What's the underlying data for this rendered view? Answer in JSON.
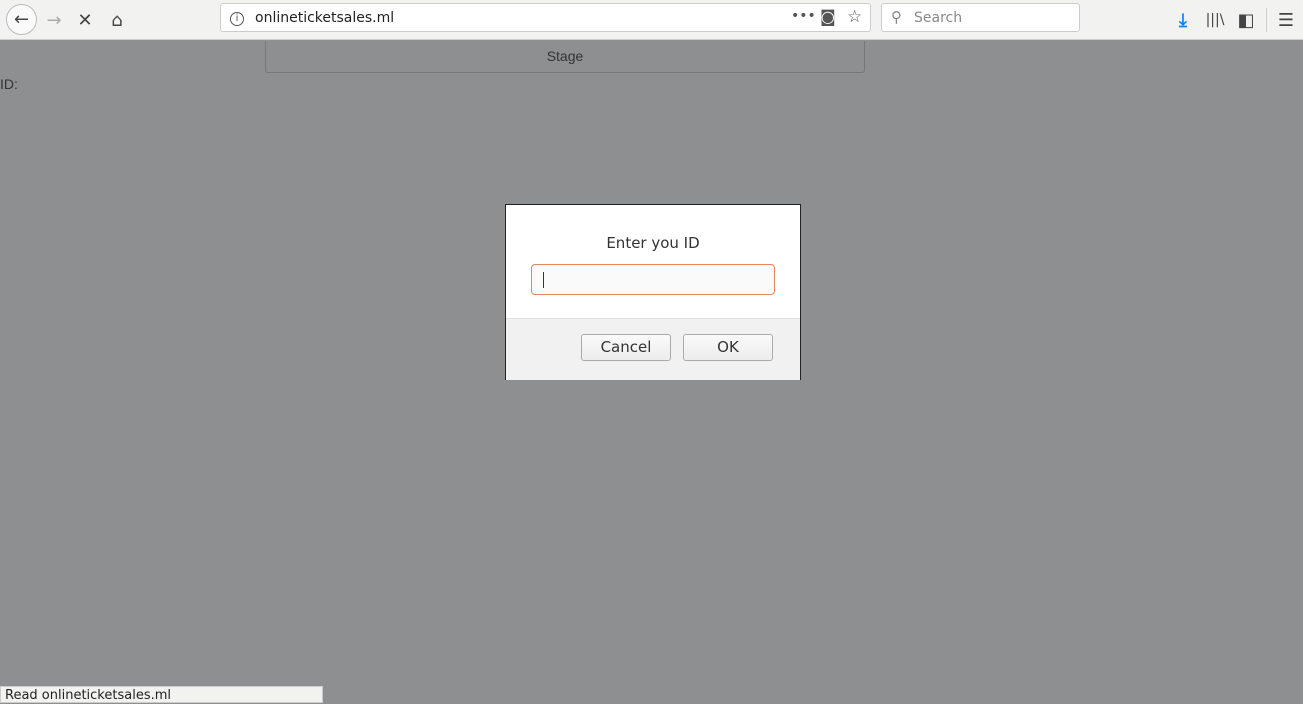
{
  "browser": {
    "url": "onlineticketsales.ml",
    "search_placeholder": "Search"
  },
  "page": {
    "stage_label": "Stage",
    "id_label": "ID:"
  },
  "dialog": {
    "message": "Enter you ID",
    "input_value": "",
    "cancel_label": "Cancel",
    "ok_label": "OK"
  },
  "status_bar": {
    "text": "Read onlineticketsales.ml"
  },
  "colors": {
    "accent_download": "#0a84ff",
    "input_focus": "#e8875e",
    "overlay": "#8e8f91"
  }
}
